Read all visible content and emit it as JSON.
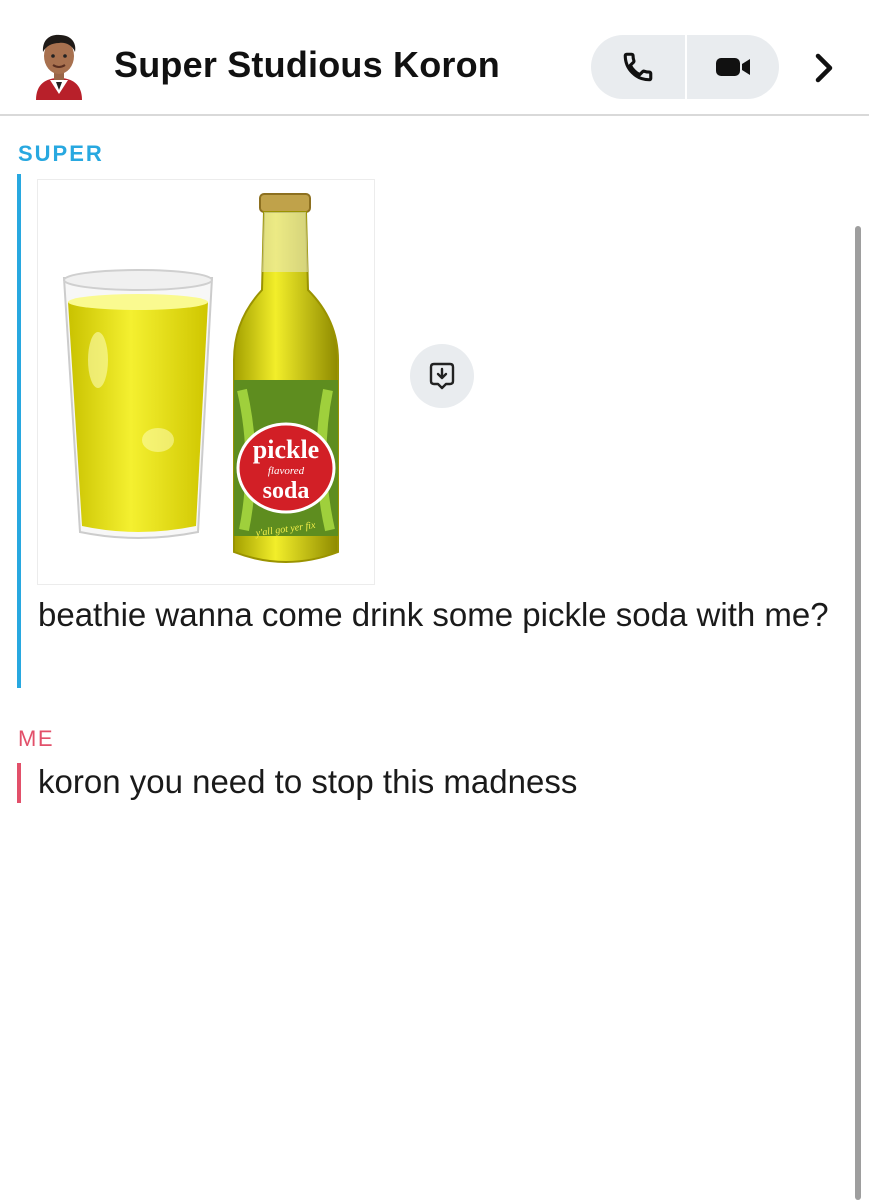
{
  "header": {
    "title": "Super Studious Koron",
    "avatar_icon": "bitmoji-avatar-icon",
    "actions": [
      "phone-icon",
      "video-camera-icon",
      "chevron-right-icon"
    ]
  },
  "messages": [
    {
      "sender_label": "SUPER",
      "sender_color": "#28a8e0",
      "media": {
        "type": "image",
        "label_main": "pickle",
        "label_sub": "flavored",
        "label_bottom": "soda",
        "tagline": "y'all got yer fix"
      },
      "text": "beathie wanna come drink some pickle soda with me?"
    },
    {
      "sender_label": "ME",
      "sender_color": "#e2506a",
      "text": "koron you need to stop this madness"
    }
  ],
  "colors": {
    "accent_blue": "#28a8e0",
    "accent_red": "#e2506a",
    "button_bg": "#e9ecef"
  }
}
